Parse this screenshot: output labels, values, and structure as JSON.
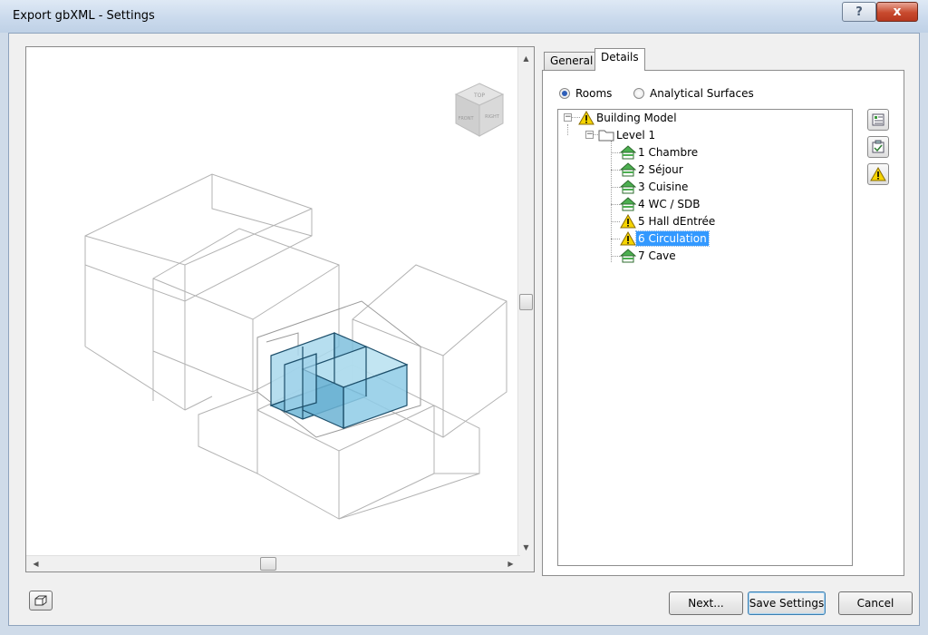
{
  "window": {
    "title": "Export gbXML - Settings",
    "help_glyph": "?",
    "close_glyph": "x"
  },
  "tabs": [
    {
      "label": "General",
      "active": false
    },
    {
      "label": "Details",
      "active": true
    }
  ],
  "details": {
    "radio_rooms": "Rooms",
    "radio_analytical": "Analytical Surfaces",
    "selected_radio": "Rooms",
    "tree": {
      "root": "Building Model",
      "level": "Level 1",
      "rooms": [
        {
          "label": "1 Chambre",
          "icon": "room-icon"
        },
        {
          "label": "2 Séjour",
          "icon": "room-icon"
        },
        {
          "label": "3 Cuisine",
          "icon": "room-icon"
        },
        {
          "label": "4 WC / SDB",
          "icon": "room-icon"
        },
        {
          "label": "5 Hall dEntrée",
          "icon": "warning-icon"
        },
        {
          "label": "6 Circulation",
          "icon": "warning-icon",
          "selected": true
        },
        {
          "label": "7 Cave",
          "icon": "room-icon"
        }
      ]
    },
    "side_buttons": [
      "room-info-icon",
      "properties-icon",
      "warning-icon"
    ]
  },
  "viewcube": {
    "face_top": "TOP",
    "face_front": "FRONT",
    "face_right": "RIGHT"
  },
  "buttons": {
    "next": "Next...",
    "save": "Save Settings",
    "cancel": "Cancel"
  },
  "colors": {
    "selection": "#3399ff",
    "room_fill": "#8ecbe6",
    "warning": "#f5d400"
  }
}
